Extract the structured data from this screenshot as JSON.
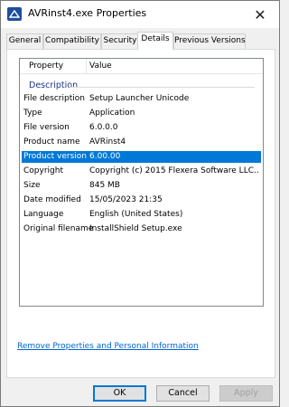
{
  "window": {
    "title": "AVRinst4.exe Properties",
    "close_glyph": "✕"
  },
  "tabs": [
    {
      "label": "General"
    },
    {
      "label": "Compatibility"
    },
    {
      "label": "Security"
    },
    {
      "label": "Details",
      "active": true
    },
    {
      "label": "Previous Versions"
    }
  ],
  "details": {
    "columns": {
      "property": "Property",
      "value": "Value"
    },
    "group": "Description",
    "rows": [
      {
        "property": "File description",
        "value": "Setup Launcher Unicode"
      },
      {
        "property": "Type",
        "value": "Application"
      },
      {
        "property": "File version",
        "value": "6.0.0.0"
      },
      {
        "property": "Product name",
        "value": "AVRinst4"
      },
      {
        "property": "Product version",
        "value": "6.00.00",
        "selected": true
      },
      {
        "property": "Copyright",
        "value": "Copyright (c) 2015 Flexera Software LLC..."
      },
      {
        "property": "Size",
        "value": "845 MB"
      },
      {
        "property": "Date modified",
        "value": "15/05/2023 21:35"
      },
      {
        "property": "Language",
        "value": "English (United States)"
      },
      {
        "property": "Original filename",
        "value": "InstallShield Setup.exe"
      }
    ]
  },
  "remove_link": "Remove Properties and Personal Information",
  "buttons": {
    "ok": "OK",
    "cancel": "Cancel",
    "apply": "Apply"
  },
  "colors": {
    "selection": "#0078d7",
    "link": "#0066cc",
    "group_title": "#1e3287"
  }
}
